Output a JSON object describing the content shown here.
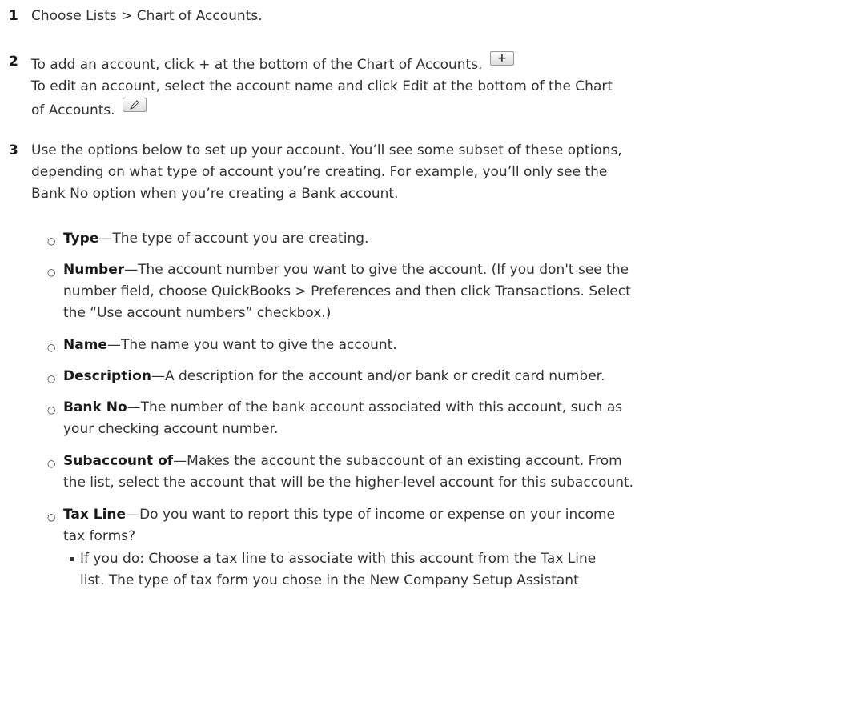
{
  "steps": [
    {
      "num": "1",
      "lines": [
        "Choose Lists > Chart of Accounts."
      ]
    },
    {
      "num": "2",
      "line1": "To add an account, click + at the bottom of the Chart of Accounts.",
      "add_icon": "plus-button-icon",
      "line2": "To edit an account, select the account name and click Edit at the bottom of the Chart",
      "line3": "of Accounts.",
      "edit_icon": "pencil-button-icon"
    },
    {
      "num": "3",
      "lines": [
        "Use the options below to set up your account. You’ll see some subset of these options,",
        "depending on what type of account you’re creating. For example, you’ll only see the",
        "Bank No option when you’re creating a Bank account."
      ]
    }
  ],
  "bullet_mark": "○",
  "options": [
    {
      "term": "Type",
      "lines": [
        "—The type of account you are creating."
      ]
    },
    {
      "term": "Number",
      "lines": [
        "—The account number you want to give the account. (If you don't see the",
        "number field, choose QuickBooks > Preferences and then click Transactions. Select",
        "the “Use account numbers” checkbox.)"
      ]
    },
    {
      "term": "Name",
      "lines": [
        "—The name you want to give the account."
      ]
    },
    {
      "term": "Description",
      "lines": [
        "—A description for the account and/or bank or credit card number."
      ]
    },
    {
      "term": "Bank No",
      "lines": [
        "—The number of the bank account associated with this account, such as",
        "your checking account number."
      ]
    },
    {
      "term": "Subaccount of",
      "lines": [
        "—Makes the account the subaccount of an existing account. From",
        "the list, select the account that will be the higher-level account for this subaccount."
      ]
    },
    {
      "term": "Tax Line",
      "lines": [
        "—Do you want to report this type of income or expense on your income",
        "tax forms?"
      ]
    }
  ],
  "sub_bullets": [
    {
      "lines": [
        "If you do: Choose a tax line to associate with this account from the Tax Line",
        "list. The type of tax form you chose in the New Company Setup Assistant"
      ]
    }
  ]
}
